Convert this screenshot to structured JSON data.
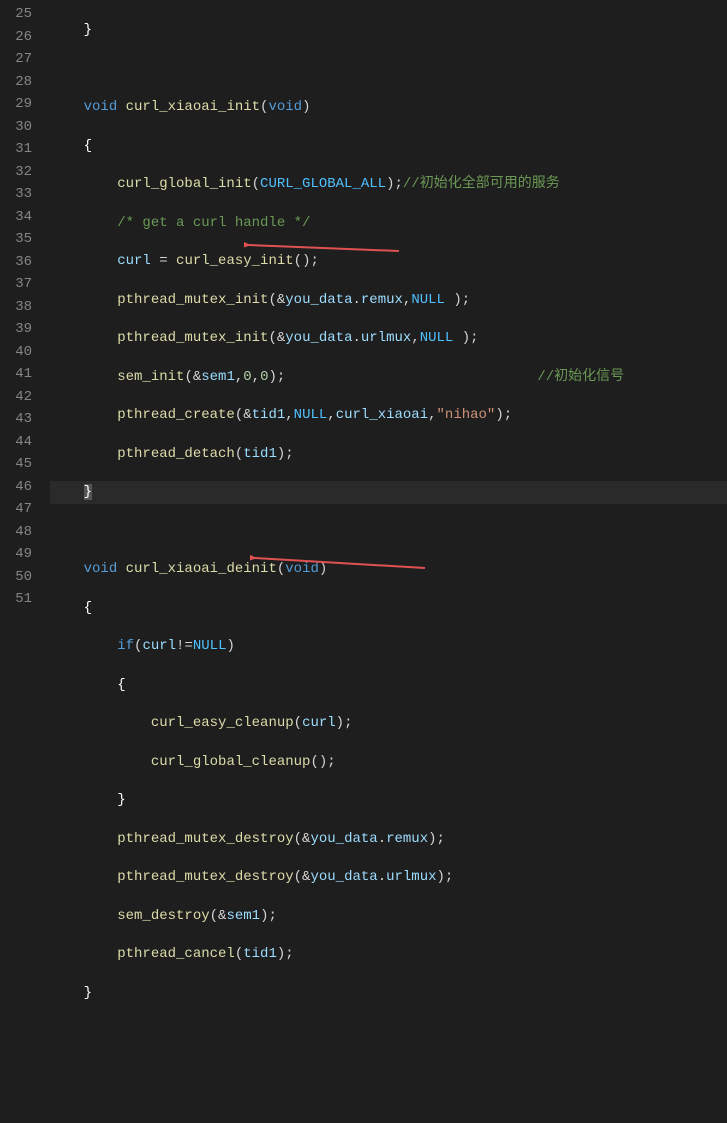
{
  "line_numbers": [
    "25",
    "26",
    "27",
    "28",
    "29",
    "30",
    "31",
    "32",
    "33",
    "34",
    "35",
    "36",
    "37",
    "38",
    "39",
    "40",
    "41",
    "42",
    "43",
    "44",
    "45",
    "46",
    "47",
    "48",
    "49",
    "50",
    "51"
  ],
  "l25": {
    "brace": "}"
  },
  "l27": {
    "kw1": "void",
    "sp1": " ",
    "fn": "curl_xiaoai_init",
    "op1": "(",
    "kw2": "void",
    "op2": ")"
  },
  "l28": {
    "brace": "{"
  },
  "l29": {
    "fn": "curl_global_init",
    "op1": "(",
    "const": "CURL_GLOBAL_ALL",
    "op2": ");",
    "com": "//初始化全部可用的服务"
  },
  "l30": {
    "com": "/* get a curl handle */"
  },
  "l31": {
    "var": "curl",
    "op1": " = ",
    "fn": "curl_easy_init",
    "op2": "();"
  },
  "l32": {
    "fn": "pthread_mutex_init",
    "op1": "(&",
    "var1": "you_data",
    "dot": ".",
    "var2": "remux",
    "comma": ",",
    "const": "NULL",
    "sp": " ",
    "op2": ");"
  },
  "l33": {
    "fn": "pthread_mutex_init",
    "op1": "(&",
    "var1": "you_data",
    "dot": ".",
    "var2": "urlmux",
    "comma": ",",
    "const": "NULL",
    "sp": " ",
    "op2": ");"
  },
  "l34": {
    "fn": "sem_init",
    "op1": "(&",
    "var": "sem1",
    "comma1": ",",
    "n1": "0",
    "comma2": ",",
    "n2": "0",
    "op2": ");",
    "sp": "                              ",
    "com": "//初始化信号"
  },
  "l35": {
    "fn": "pthread_create",
    "op1": "(&",
    "var1": "tid1",
    "comma1": ",",
    "const": "NULL",
    "comma2": ",",
    "var2": "curl_xiaoai",
    "comma3": ",",
    "str": "\"nihao\"",
    "op2": ");"
  },
  "l36": {
    "fn": "pthread_detach",
    "op1": "(",
    "var": "tid1",
    "op2": ");"
  },
  "l37": {
    "brace": "}"
  },
  "l39": {
    "kw1": "void",
    "sp1": " ",
    "fn": "curl_xiaoai_deinit",
    "op1": "(",
    "kw2": "void",
    "op2": ")"
  },
  "l40": {
    "brace": "{"
  },
  "l41": {
    "kw": "if",
    "op1": "(",
    "var": "curl",
    "op2": "!=",
    "const": "NULL",
    "op3": ")"
  },
  "l42": {
    "brace": "{"
  },
  "l43": {
    "fn": "curl_easy_cleanup",
    "op1": "(",
    "var": "curl",
    "op2": ");"
  },
  "l44": {
    "fn": "curl_global_cleanup",
    "op1": "();"
  },
  "l45": {
    "brace": "}"
  },
  "l46": {
    "fn": "pthread_mutex_destroy",
    "op1": "(&",
    "var1": "you_data",
    "dot": ".",
    "var2": "remux",
    "op2": ");"
  },
  "l47": {
    "fn": "pthread_mutex_destroy",
    "op1": "(&",
    "var1": "you_data",
    "dot": ".",
    "var2": "urlmux",
    "op2": ");"
  },
  "l48": {
    "fn": "sem_destroy",
    "op1": "(&",
    "var": "sem1",
    "op2": ");"
  },
  "l49": {
    "fn": "pthread_cancel",
    "op1": "(",
    "var": "tid1",
    "op2": ");"
  },
  "l50": {
    "brace": "}"
  }
}
